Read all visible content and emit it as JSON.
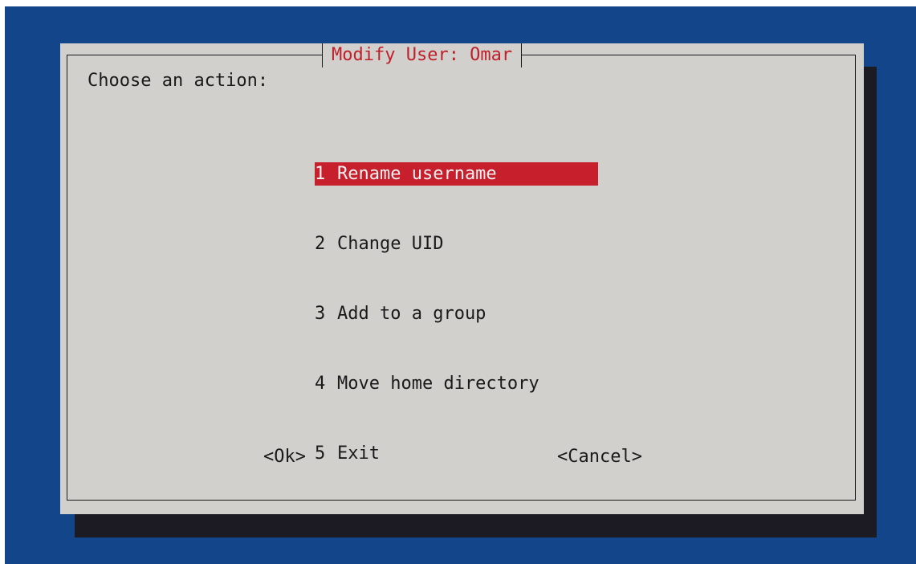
{
  "colors": {
    "background": "#13458a",
    "dialog": "#d2d0cd",
    "shadow": "#1c1a23",
    "accent": "#c71f2c"
  },
  "dialog": {
    "title": "Modify User: Omar",
    "prompt": "Choose an action:"
  },
  "menu": {
    "selected_index": 0,
    "items": [
      {
        "tag": "1",
        "label": "Rename username"
      },
      {
        "tag": "2",
        "label": "Change UID"
      },
      {
        "tag": "3",
        "label": "Add to a group"
      },
      {
        "tag": "4",
        "label": "Move home directory"
      },
      {
        "tag": "5",
        "label": "Exit"
      }
    ]
  },
  "buttons": {
    "ok": "<Ok>",
    "cancel": "<Cancel>"
  }
}
